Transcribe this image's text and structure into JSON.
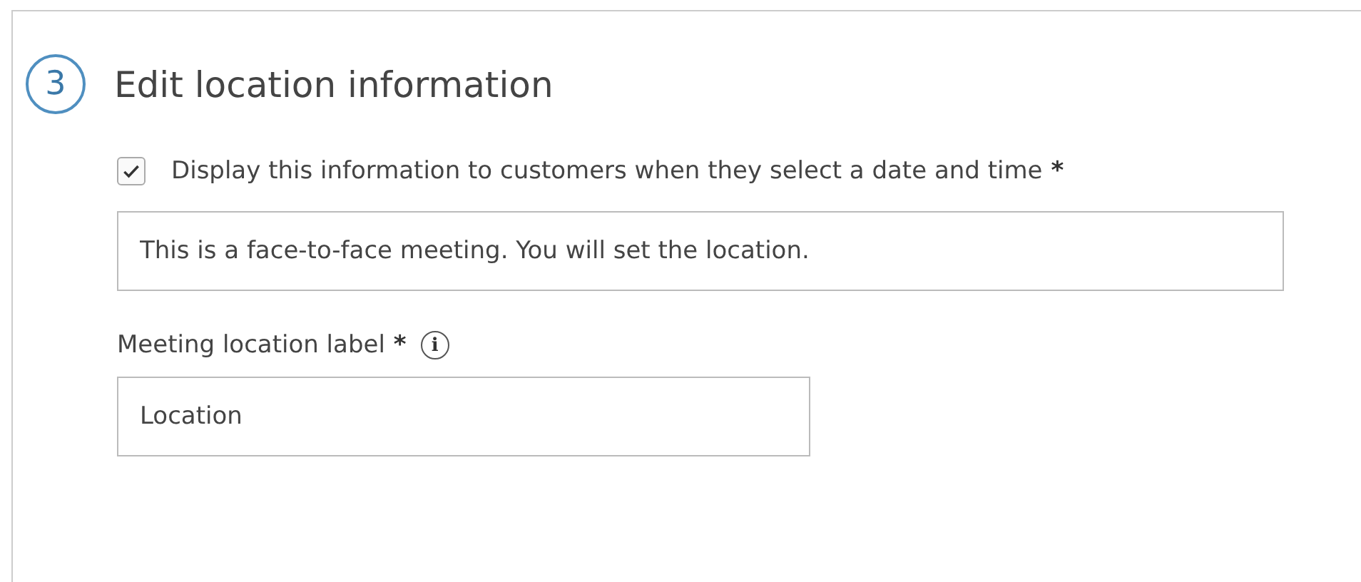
{
  "step": {
    "number": "3",
    "title": "Edit location information"
  },
  "display_option": {
    "label": "Display this information to customers when they select a date and time",
    "required_mark": "*",
    "checked": true
  },
  "info_field": {
    "value": "This is a face-to-face meeting. You will set the location."
  },
  "location_label_field": {
    "label": "Meeting location label",
    "required_mark": "*",
    "info_icon": "i",
    "value": "Location"
  }
}
